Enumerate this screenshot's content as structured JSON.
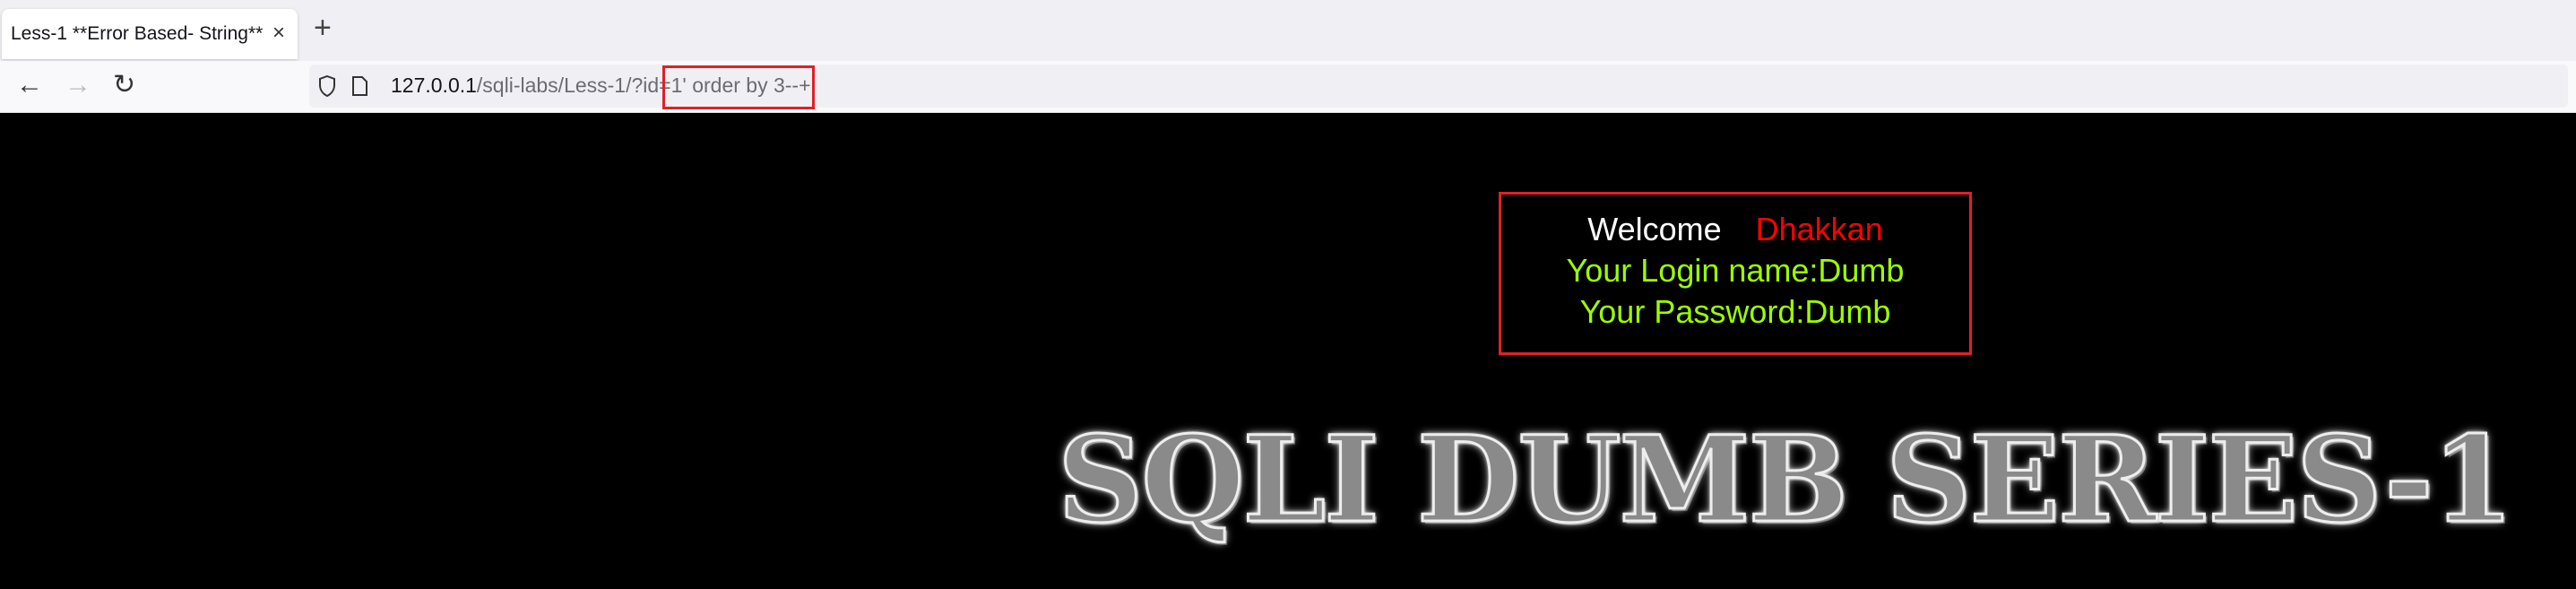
{
  "browser": {
    "tab_title": "Less-1 **Error Based- String**",
    "tab_close": "×",
    "new_tab": "+",
    "back": "←",
    "forward": "→",
    "reload": "↻",
    "url_host": "127.0.0.1",
    "url_path": "/sqli-labs/Less-1/?id=",
    "url_query": "1' order by 3--+"
  },
  "login": {
    "welcome": "Welcome",
    "user": "Dhakkan",
    "login_name": "Your Login name:Dumb",
    "password": "Your Password:Dumb"
  },
  "banner": {
    "title": "SQLI DUMB SERIES-1"
  }
}
